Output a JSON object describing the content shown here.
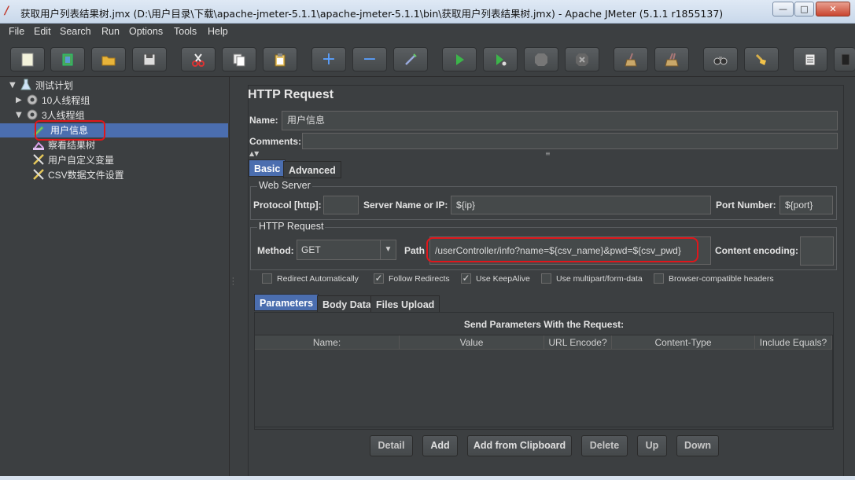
{
  "window": {
    "title": "获取用户列表结果树.jmx (D:\\用户目录\\下载\\apache-jmeter-5.1.1\\apache-jmeter-5.1.1\\bin\\获取用户列表结果树.jmx) - Apache JMeter (5.1.1 r1855137)",
    "min_label": "—",
    "max_label": "□",
    "close_label": "✕"
  },
  "menu": [
    "File",
    "Edit",
    "Search",
    "Run",
    "Options",
    "Tools",
    "Help"
  ],
  "tree": {
    "root": "测试计划",
    "group1": "10人线程组",
    "group2": "3人线程组",
    "request": "用户信息",
    "listener": "察看结果树",
    "vars": "用户自定义变量",
    "csv": "CSV数据文件设置"
  },
  "panel": {
    "title": "HTTP Request",
    "name_label": "Name:",
    "name_value": "用户信息",
    "comments_label": "Comments:",
    "tabs": [
      "Basic",
      "Advanced"
    ],
    "web_server": {
      "title": "Web Server",
      "protocol_label": "Protocol [http]:",
      "protocol_value": "",
      "server_label": "Server Name or IP:",
      "server_value": "${ip}",
      "port_label": "Port Number:",
      "port_value": "${port}"
    },
    "http_request": {
      "title": "HTTP Request",
      "method_label": "Method:",
      "method_value": "GET",
      "path_label": "Path",
      "path_value": "/userController/info?name=${csv_name}&pwd=${csv_pwd}",
      "encoding_label": "Content encoding:"
    },
    "checkboxes": [
      {
        "label": "Redirect Automatically",
        "checked": false
      },
      {
        "label": "Follow Redirects",
        "checked": true
      },
      {
        "label": "Use KeepAlive",
        "checked": true
      },
      {
        "label": "Use multipart/form-data",
        "checked": false
      },
      {
        "label": "Browser-compatible headers",
        "checked": false
      }
    ],
    "sub_tabs": [
      "Parameters",
      "Body Data",
      "Files Upload"
    ],
    "params_title": "Send Parameters With the Request:",
    "columns": [
      "Name:",
      "Value",
      "URL Encode?",
      "Content-Type",
      "Include Equals?"
    ],
    "buttons": [
      "Detail",
      "Add",
      "Add from Clipboard",
      "Delete",
      "Up",
      "Down"
    ]
  },
  "colors": {
    "background": "#3c3f41",
    "selection": "#4b6eaf",
    "highlight_box": "#e0161b"
  }
}
